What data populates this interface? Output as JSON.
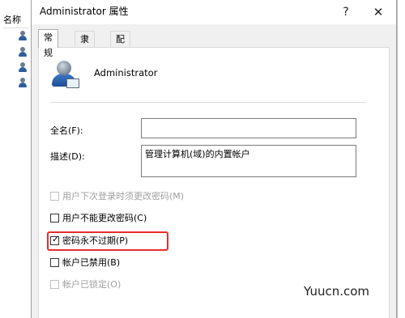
{
  "background_window": {
    "header_label": "名称"
  },
  "dialog": {
    "title": "Administrator 属性",
    "help_glyph": "?",
    "close_glyph": "✕",
    "tabs": [
      {
        "label": "常规",
        "active": true
      },
      {
        "label": "隶属于",
        "active": false
      },
      {
        "label": "配置文件",
        "active": false
      }
    ],
    "user": {
      "name": "Administrator",
      "icon": "user-account-icon"
    },
    "fields": {
      "full_name_label": "全名(F):",
      "full_name_value": "",
      "description_label": "描述(D):",
      "description_value": "管理计算机(域)的内置帐户"
    },
    "checkboxes": [
      {
        "label": "用户下次登录时须更改密码(M)",
        "checked": false,
        "disabled": true
      },
      {
        "label": "用户不能更改密码(C)",
        "checked": false,
        "disabled": false
      },
      {
        "label": "密码永不过期(P)",
        "checked": true,
        "disabled": false
      },
      {
        "label": "帐户已禁用(B)",
        "checked": false,
        "disabled": false
      },
      {
        "label": "帐户已锁定(O)",
        "checked": false,
        "disabled": true
      }
    ],
    "highlight_color": "#e52e2e"
  },
  "watermark": "Yuucn.com"
}
